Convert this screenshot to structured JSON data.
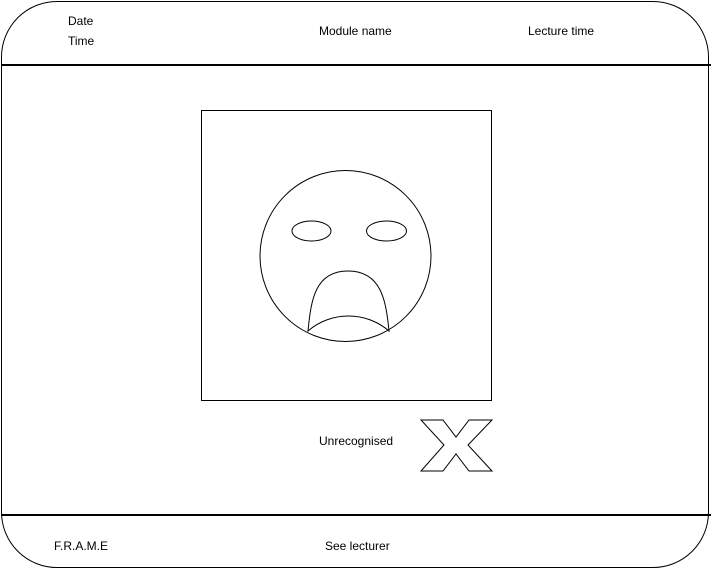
{
  "header": {
    "date_label": "Date",
    "time_label": "Time",
    "module_label": "Module name",
    "lecture_time_label": "Lecture time"
  },
  "main": {
    "camera_icon": "sad-face-icon",
    "status_text": "Unrecognised",
    "status_icon": "cross-icon"
  },
  "footer": {
    "brand": "F.R.A.M.E",
    "see_lecturer": "See lecturer"
  }
}
